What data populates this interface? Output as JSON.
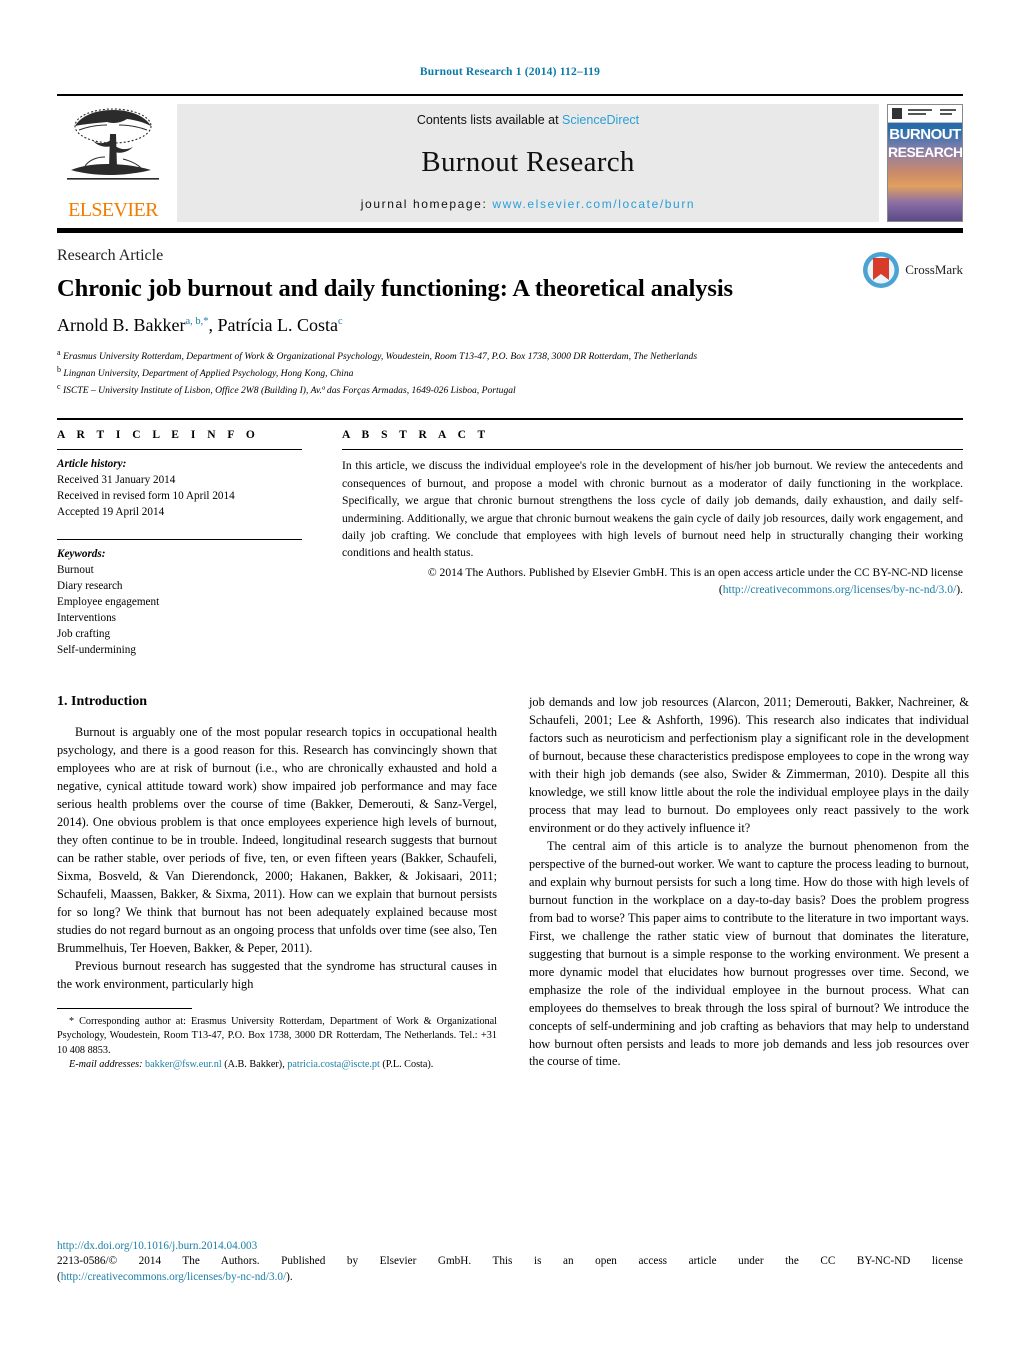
{
  "running_head": "Burnout Research 1 (2014) 112–119",
  "masthead": {
    "publisher": "ELSEVIER",
    "contents_prefix": "Contents lists available at ",
    "contents_link": "ScienceDirect",
    "journal_name": "Burnout Research",
    "homepage_prefix": "journal homepage: ",
    "homepage_url": "www.elsevier.com/locate/burn",
    "cover_word_1": "BURNOUT",
    "cover_word_2": "RESEARCH"
  },
  "article": {
    "doctype": "Research Article",
    "title": "Chronic job burnout and daily functioning: A theoretical analysis",
    "authors": [
      {
        "name": "Arnold B. Bakker",
        "sup": "a, b,",
        "star": "*"
      },
      {
        "name": "Patrícia L. Costa",
        "sup": "c",
        "star": ""
      }
    ],
    "affiliations": [
      {
        "marker": "a",
        "text": "Erasmus University Rotterdam, Department of Work & Organizational Psychology, Woudestein, Room T13-47, P.O. Box 1738, 3000 DR Rotterdam, The Netherlands"
      },
      {
        "marker": "b",
        "text": "Lingnan University, Department of Applied Psychology, Hong Kong, China"
      },
      {
        "marker": "c",
        "text": "ISCTE – University Institute of Lisbon, Office 2W8 (Building I), Av.ª das Forças Armadas, 1649-026 Lisboa, Portugal"
      }
    ],
    "crossmark_label": "CrossMark"
  },
  "article_info": {
    "heading": "A R T I C L E   I N F O",
    "history_label": "Article history:",
    "history": [
      "Received 31 January 2014",
      "Received in revised form 10 April 2014",
      "Accepted 19 April 2014"
    ],
    "keywords_label": "Keywords:",
    "keywords": [
      "Burnout",
      "Diary research",
      "Employee engagement",
      "Interventions",
      "Job crafting",
      "Self-undermining"
    ]
  },
  "abstract": {
    "heading": "A B S T R A C T",
    "text": "In this article, we discuss the individual employee's role in the development of his/her job burnout. We review the antecedents and consequences of burnout, and propose a model with chronic burnout as a moderator of daily functioning in the workplace. Specifically, we argue that chronic burnout strengthens the loss cycle of daily job demands, daily exhaustion, and daily self-undermining. Additionally, we argue that chronic burnout weakens the gain cycle of daily job resources, daily work engagement, and daily job crafting. We conclude that employees with high levels of burnout need help in structurally changing their working conditions and health status.",
    "copyright_text": "© 2014 The Authors. Published by Elsevier GmbH. This is an open access article under the CC BY-NC-ND license (",
    "copyright_link": "http://creativecommons.org/licenses/by-nc-nd/3.0/",
    "copyright_suffix": ")."
  },
  "body": {
    "section_title": "1.  Introduction",
    "left_paragraphs": [
      "Burnout is arguably one of the most popular research topics in occupational health psychology, and there is a good reason for this. Research has convincingly shown that employees who are at risk of burnout (i.e., who are chronically exhausted and hold a negative, cynical attitude toward work) show impaired job performance and may face serious health problems over the course of time (Bakker, Demerouti, & Sanz-Vergel, 2014). One obvious problem is that once employees experience high levels of burnout, they often continue to be in trouble. Indeed, longitudinal research suggests that burnout can be rather stable, over periods of five, ten, or even fifteen years (Bakker, Schaufeli, Sixma, Bosveld, & Van Dierendonck, 2000; Hakanen, Bakker, & Jokisaari, 2011; Schaufeli, Maassen, Bakker, & Sixma, 2011). How can we explain that burnout persists for so long? We think that burnout has not been adequately explained because most studies do not regard burnout as an ongoing process that unfolds over time (see also, Ten Brummelhuis, Ter Hoeven, Bakker, & Peper, 2011).",
      "Previous burnout research has suggested that the syndrome has structural causes in the work environment, particularly high"
    ],
    "right_paragraphs": [
      "job demands and low job resources (Alarcon, 2011; Demerouti, Bakker, Nachreiner, & Schaufeli, 2001; Lee & Ashforth, 1996). This research also indicates that individual factors such as neuroticism and perfectionism play a significant role in the development of burnout, because these characteristics predispose employees to cope in the wrong way with their high job demands (see also, Swider & Zimmerman, 2010). Despite all this knowledge, we still know little about the role the individual employee plays in the daily process that may lead to burnout. Do employees only react passively to the work environment or do they actively influence it?",
      "The central aim of this article is to analyze the burnout phenomenon from the perspective of the burned-out worker. We want to capture the process leading to burnout, and explain why burnout persists for such a long time. How do those with high levels of burnout function in the workplace on a day-to-day basis? Does the problem progress from bad to worse? This paper aims to contribute to the literature in two important ways. First, we challenge the rather static view of burnout that dominates the literature, suggesting that burnout is a simple response to the working environment. We present a more dynamic model that elucidates how burnout progresses over time. Second, we emphasize the role of the individual employee in the burnout process. What can employees do themselves to break through the loss spiral of burnout? We introduce the concepts of self-undermining and job crafting as behaviors that may help to understand how burnout often persists and leads to more job demands and less job resources over the course of time."
    ]
  },
  "footnotes": {
    "corresponding": "* Corresponding author at: Erasmus University Rotterdam, Department of Work & Organizational Psychology, Woudestein, Room T13-47, P.O. Box 1738, 3000 DR Rotterdam, The Netherlands. Tel.: +31 10 408 8853.",
    "email_label": "E-mail addresses:",
    "email_1": "bakker@fsw.eur.nl",
    "email_1_owner": " (A.B. Bakker), ",
    "email_2": "patricia.costa@iscte.pt",
    "email_2_owner": " (P.L. Costa)."
  },
  "bottom": {
    "doi": "http://dx.doi.org/10.1016/j.burn.2014.04.003",
    "issn_line": "2213-0586/© 2014 The Authors. Published by Elsevier GmbH. This is an open access article under the CC BY-NC-ND license",
    "license_open": "(",
    "license_link": "http://creativecommons.org/licenses/by-nc-nd/3.0/",
    "license_close": ")."
  }
}
